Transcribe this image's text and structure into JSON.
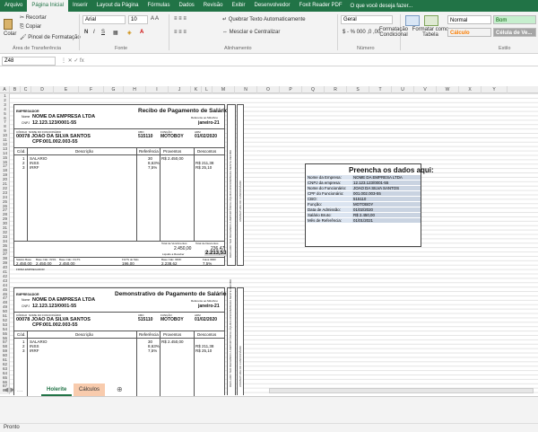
{
  "tabs": [
    "Arquivo",
    "Página Inicial",
    "Inserir",
    "Layout da Página",
    "Fórmulas",
    "Dados",
    "Revisão",
    "Exibir",
    "Desenvolvedor",
    "Foxit Reader PDF"
  ],
  "tell_me": "O que você deseja fazer...",
  "clipboard": {
    "cut": "Recortar",
    "copy": "Copiar",
    "paste": "Colar",
    "painter": "Pincel de Formatação",
    "group": "Área de Transferência"
  },
  "font": {
    "name": "Arial",
    "size": "10",
    "group": "Fonte"
  },
  "alignment": {
    "wrap": "Quebrar Texto Automaticamente",
    "merge": "Mesclar e Centralizar",
    "group": "Alinhamento"
  },
  "number": {
    "format": "Geral",
    "group": "Número"
  },
  "styles": {
    "cond": "Formatação Condicional",
    "table": "Formatar como Tabela",
    "normal": "Normal",
    "good": "Bom",
    "calc": "Cálculo",
    "check": "Célula de Ve...",
    "group": "Estilo"
  },
  "namebox": "Z48",
  "columns": [
    "A",
    "B",
    "C",
    "D",
    "E",
    "F",
    "G",
    "H",
    "I",
    "J",
    "K",
    "L",
    "M",
    "N",
    "O",
    "P",
    "Q",
    "R",
    "S",
    "T",
    "U",
    "V",
    "W",
    "X",
    "Y"
  ],
  "receipt1": {
    "title": "Recibo de Pagamento de Salário",
    "employer_label": "EMPREGADOR",
    "name_label": "Nome",
    "company": "NOME DA EMPRESA LTDA",
    "cnpj_label": "CNPJ",
    "cnpj": "12.123.123/0001-55",
    "ref_label": "Referente ao Mês/Ano",
    "ref": "janeiro-21",
    "code_label": "CÓDIGO",
    "emp_label": "NOME DO FUNCIONÁRIO",
    "code": "00078",
    "employee": "JOAO DA SILVA SANTOS",
    "cpf_label": "CPF:",
    "cpf": "001.002.003-55",
    "cbo_label": "CBO",
    "cbo": "515110",
    "func_label": "FUNÇÃO",
    "func": "MOTOBOY",
    "adm_label": "ADM",
    "adm": "01/02/2020",
    "cols": [
      "Cód.",
      "Descrição",
      "Referência",
      "Proventos",
      "Descontos"
    ],
    "items": [
      {
        "code": "1",
        "desc": "SALARIO",
        "ref": "30",
        "prov": "R$ 2.450,00",
        "desc_val": ""
      },
      {
        "code": "2",
        "desc": "INSS",
        "ref": "8,63%",
        "prov": "",
        "desc_val": "R$ 211,38"
      },
      {
        "code": "3",
        "desc": "IRRF",
        "ref": "7,5%",
        "prov": "",
        "desc_val": "R$ 25,10"
      }
    ],
    "total_prov_label": "Total de Vencimentos",
    "total_desc_label": "Total de Descontos",
    "total_prov": "2.450,00",
    "total_desc": "236,47",
    "net_label": "Líquido a Receber",
    "net": "2.213,53",
    "footer_labels": [
      "Salário Base",
      "Base Cálc. INSS",
      "Base Cálc. FGTS",
      "FGTS do Mês",
      "Base Cálc. IRRF",
      "Faixa IRRF"
    ],
    "footer_vals": [
      "2.450,00",
      "2.450,00",
      "2.450,00",
      "196,00",
      "2.238,62",
      "7,5%"
    ],
    "sign_label": "FIRMA EMPREGADOR",
    "side_text": "DECLARO TER RECEBIDO A IMPORTÂNCIA LÍQUIDA DISCRIMINADA NESTE RECIBO",
    "side_sign": "ASSINATURA DO FUNCIONÁRIO",
    "side_date": "DATA"
  },
  "receipt2": {
    "title": "Demonstrativo de Pagamento de Salário",
    "employer_label": "EMPREGADOR",
    "name_label": "Nome",
    "company": "NOME DA EMPRESA LTDA",
    "cnpj_label": "CNPJ",
    "cnpj": "12.123.123/0001-55",
    "ref_label": "Referente ao Mês/Ano",
    "ref": "janeiro-21",
    "code_label": "CÓDIGO",
    "emp_label": "NOME DO FUNCIONÁRIO",
    "code": "00078",
    "employee": "JOAO DA SILVA SANTOS",
    "cpf_label": "CPF:",
    "cpf": "001.002.003-55",
    "cbo_label": "CBO",
    "cbo": "515110",
    "func_label": "FUNÇÃO",
    "func": "MOTOBOY",
    "adm_label": "ADM",
    "adm": "01/02/2020",
    "cols": [
      "Cód.",
      "Descrição",
      "Referência",
      "Proventos",
      "Descontos"
    ],
    "items": [
      {
        "code": "1",
        "desc": "SALARIO",
        "ref": "30",
        "prov": "R$ 2.450,00",
        "desc_val": ""
      },
      {
        "code": "2",
        "desc": "INSS",
        "ref": "8,63%",
        "prov": "",
        "desc_val": "R$ 211,38"
      },
      {
        "code": "3",
        "desc": "IRRF",
        "ref": "7,5%",
        "prov": "",
        "desc_val": "R$ 25,10"
      }
    ],
    "side_text": "DECLARO TER RECEBIDO A IMPORTÂNCIA LÍQUIDA DISCRIMINADA NESTE RECIBO",
    "side_sign": "ASSINATURA DO FUNCIONÁRIO"
  },
  "panel": {
    "title": "Preencha os dados aqui:",
    "rows": [
      {
        "label": "Nome da Empresa:",
        "value": "NOME DA EMPRESA LTDA"
      },
      {
        "label": "CNPJ da empresa:",
        "value": "12.123.123/0001-55"
      },
      {
        "label": "Nome do Funcionário:",
        "value": "JOAO DA SILVA SANTOS"
      },
      {
        "label": "CPF do Funcionário:",
        "value": "001.002.003-55"
      },
      {
        "label": "CBO:",
        "value": "515110"
      },
      {
        "label": "Função:",
        "value": "MOTOBOY"
      },
      {
        "label": "Data de Admissão:",
        "value": "01/02/2020"
      },
      {
        "label": "Salário Bruto:",
        "value": "R$ 2.450,00"
      },
      {
        "label": "Mês de Referência:",
        "value": "01/01/2021"
      }
    ]
  },
  "sheets": [
    "Holerite",
    "Cálculos"
  ],
  "status": "Pronto"
}
